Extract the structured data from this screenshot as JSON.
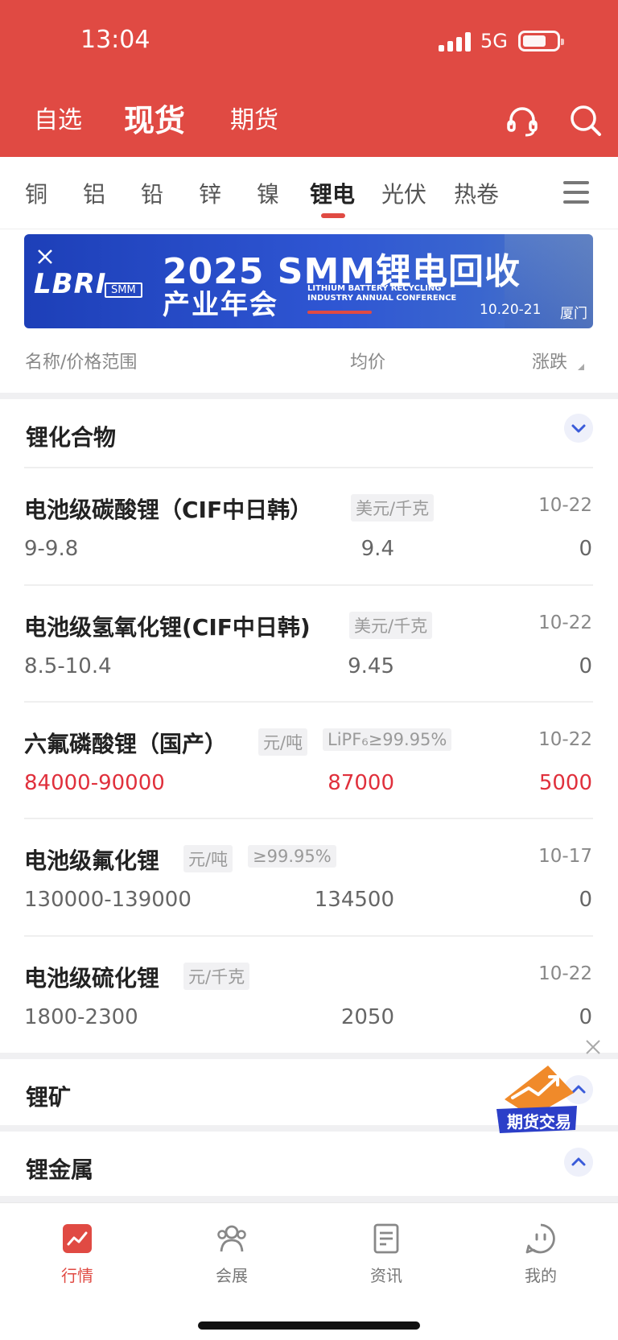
{
  "status_bar": {
    "time": "13:04",
    "network": "5G"
  },
  "header": {
    "tabs": [
      {
        "label": "自选",
        "active": false
      },
      {
        "label": "现货",
        "active": true
      },
      {
        "label": "期货",
        "active": false
      }
    ],
    "icons": [
      "headset-icon",
      "search-icon"
    ]
  },
  "categories": {
    "items": [
      "铜",
      "铝",
      "铅",
      "锌",
      "镍",
      "锂电",
      "光伏",
      "热卷"
    ],
    "active": "锂电",
    "menu_icon": "hamburger-menu-icon"
  },
  "banner": {
    "logo": "LBRI",
    "logo_sub": "SMM",
    "title": "2025 SMM锂电回收",
    "title_line2": "产业年会",
    "english": [
      "LITHIUM BATTERY RECYCLING",
      "INDUSTRY ANNUAL CONFERENCE"
    ],
    "date": "10.20-21",
    "city": "厦门"
  },
  "columns": {
    "name": "名称/价格范围",
    "avg": "均价",
    "change": "涨跌"
  },
  "sections": [
    {
      "title": "锂化合物",
      "expanded": true,
      "items": [
        {
          "name": "电池级碳酸锂（CIF中日韩）",
          "unit": "美元/千克",
          "spec": "",
          "date": "10-22",
          "range": "9-9.8",
          "avg": "9.4",
          "change": "0",
          "up": false
        },
        {
          "name": "电池级氢氧化锂(CIF中日韩)",
          "unit": "美元/千克",
          "spec": "",
          "date": "10-22",
          "range": "8.5-10.4",
          "avg": "9.45",
          "change": "0",
          "up": false
        },
        {
          "name": "六氟磷酸锂（国产）",
          "unit": "元/吨",
          "spec": "LiPF₆≥99.95%",
          "date": "10-22",
          "range": "84000-90000",
          "avg": "87000",
          "change": "5000",
          "up": true
        },
        {
          "name": "电池级氟化锂",
          "unit": "元/吨",
          "spec": "≥99.95%",
          "date": "10-17",
          "range": "130000-139000",
          "avg": "134500",
          "change": "0",
          "up": false
        },
        {
          "name": "电池级硫化锂",
          "unit": "元/千克",
          "spec": "",
          "date": "10-22",
          "range": "1800-2300",
          "avg": "2050",
          "change": "0",
          "up": false
        }
      ]
    },
    {
      "title": "锂矿",
      "expanded": false
    },
    {
      "title": "锂金属",
      "expanded": false
    }
  ],
  "floating_badge": {
    "label": "期货交易"
  },
  "bottom_nav": [
    {
      "label": "行情",
      "icon": "market-chart-icon",
      "active": true
    },
    {
      "label": "会展",
      "icon": "people-icon",
      "active": false
    },
    {
      "label": "资讯",
      "icon": "news-icon",
      "active": false
    },
    {
      "label": "我的",
      "icon": "profile-face-icon",
      "active": false
    }
  ],
  "colors": {
    "primary": "#e04a43",
    "up": "#e0303c"
  }
}
